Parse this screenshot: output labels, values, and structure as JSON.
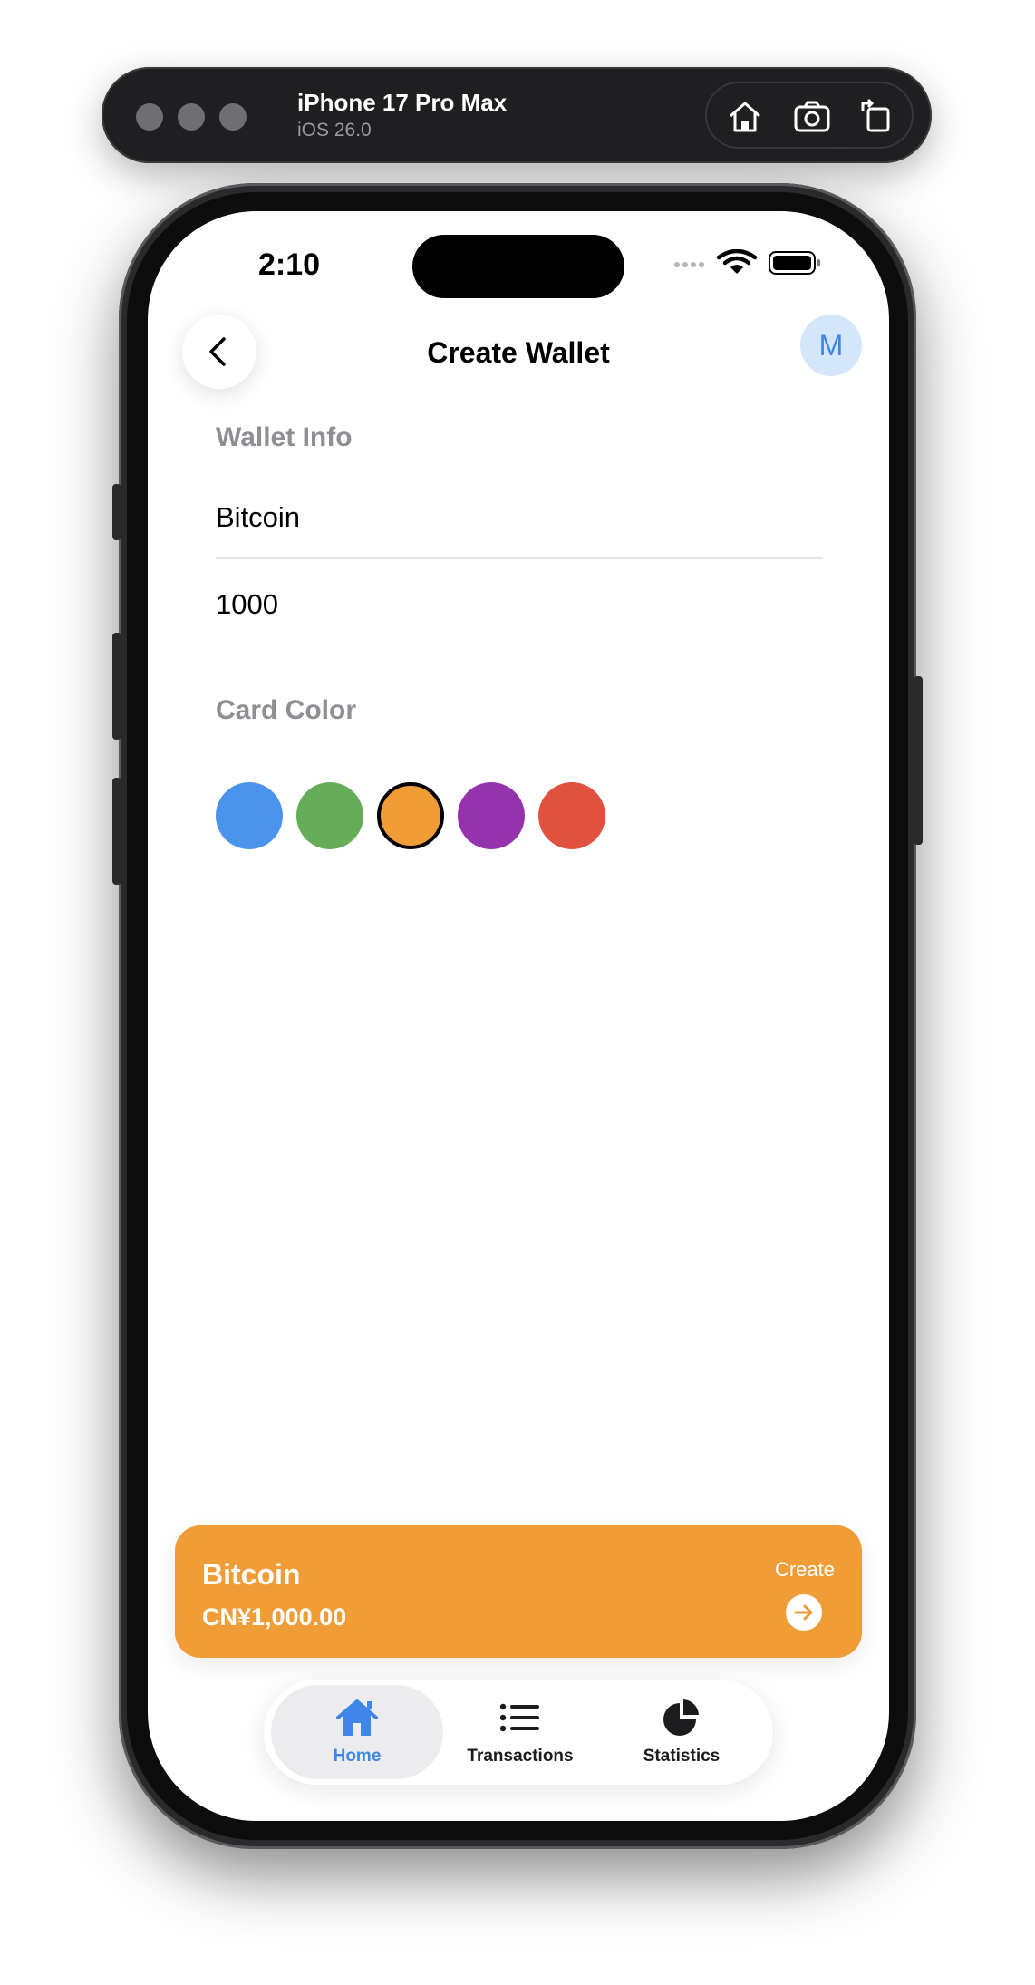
{
  "simulator": {
    "device_name": "iPhone 17 Pro Max",
    "os_version": "iOS 26.0",
    "tools": [
      "home-icon",
      "screenshot-icon",
      "rotate-icon"
    ]
  },
  "status_bar": {
    "time": "2:10"
  },
  "header": {
    "title": "Create Wallet",
    "avatar_initial": "M"
  },
  "form": {
    "section_wallet_info": "Wallet Info",
    "wallet_name_value": "Bitcoin",
    "balance_value": "1000",
    "section_card_color": "Card Color",
    "colors": [
      "#4a94ee",
      "#65ad59",
      "#f09d38",
      "#9532ad",
      "#e1513f"
    ],
    "selected_color": "#f09d38"
  },
  "preview_card": {
    "name": "Bitcoin",
    "balance": "CN¥1,000.00",
    "action_label": "Create",
    "color": "#f09d38"
  },
  "tabbar": {
    "tabs": [
      {
        "label": "Home",
        "icon": "home-icon",
        "active": true
      },
      {
        "label": "Transactions",
        "icon": "list-icon",
        "active": false
      },
      {
        "label": "Statistics",
        "icon": "pie-chart-icon",
        "active": false
      }
    ],
    "accent": "#3e86e8"
  }
}
